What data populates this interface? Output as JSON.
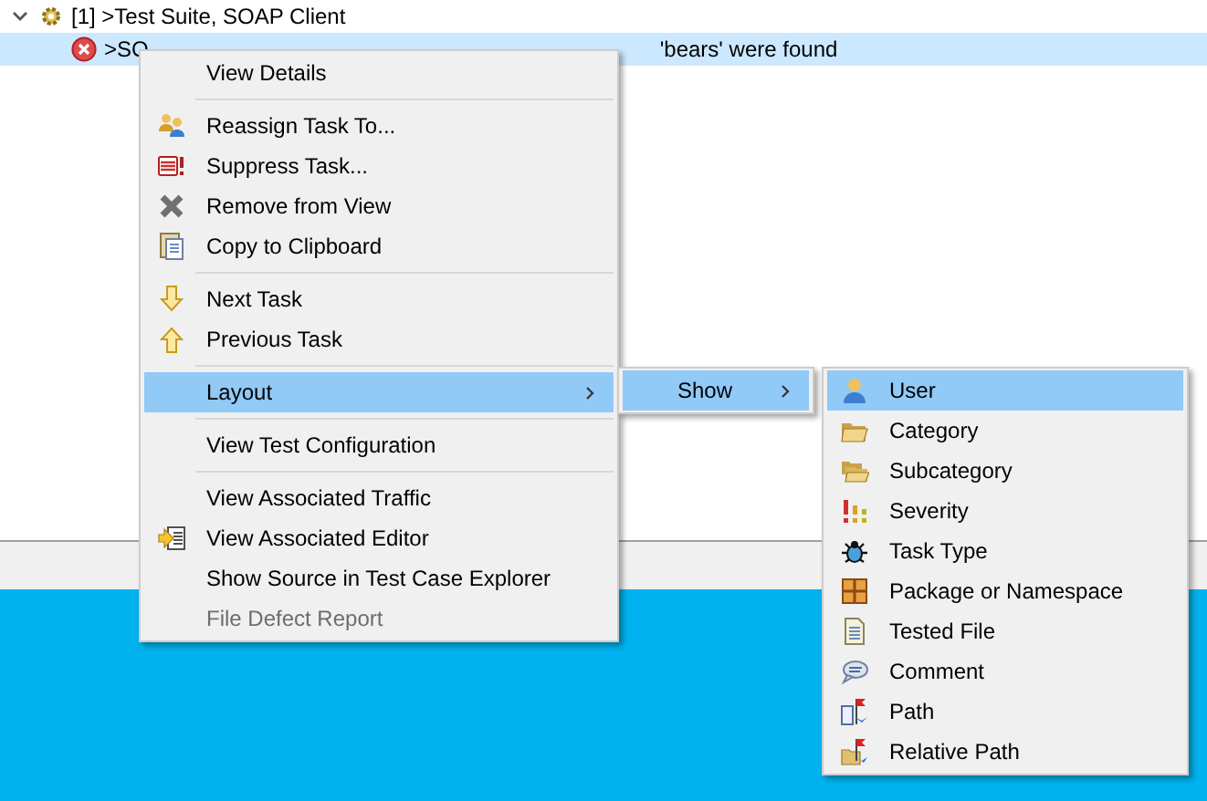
{
  "tree": [
    {
      "label": "[1] >Test Suite, SOAP Client",
      "expanded": true,
      "children": [
        {
          "label_start": ">SO",
          "label_end": "'bears' were found",
          "selected": true,
          "error": true
        }
      ]
    }
  ],
  "context_menu": {
    "items": [
      {
        "kind": "item",
        "label": "View Details",
        "selected": false,
        "disabled": false,
        "submenu": false
      },
      {
        "kind": "separator"
      },
      {
        "kind": "item",
        "label": "Reassign Task To...",
        "selected": false,
        "disabled": false,
        "submenu": false
      },
      {
        "kind": "item",
        "label": "Suppress Task...",
        "selected": false,
        "disabled": false,
        "submenu": false
      },
      {
        "kind": "item",
        "label": "Remove from View",
        "selected": false,
        "disabled": false,
        "submenu": false
      },
      {
        "kind": "item",
        "label": "Copy to Clipboard",
        "selected": false,
        "disabled": false,
        "submenu": false
      },
      {
        "kind": "separator"
      },
      {
        "kind": "item",
        "label": "Next Task",
        "selected": false,
        "disabled": false,
        "submenu": false
      },
      {
        "kind": "item",
        "label": "Previous Task",
        "selected": false,
        "disabled": false,
        "submenu": false
      },
      {
        "kind": "separator"
      },
      {
        "kind": "item",
        "label": "Layout",
        "selected": true,
        "disabled": false,
        "submenu": true
      },
      {
        "kind": "separator"
      },
      {
        "kind": "item",
        "label": "View Test Configuration",
        "selected": false,
        "disabled": false,
        "submenu": false
      },
      {
        "kind": "separator"
      },
      {
        "kind": "item",
        "label": "View Associated Traffic",
        "selected": false,
        "disabled": false,
        "submenu": false
      },
      {
        "kind": "item",
        "label": "View Associated Editor",
        "selected": false,
        "disabled": false,
        "submenu": false
      },
      {
        "kind": "item",
        "label": "Show Source in Test Case Explorer",
        "selected": false,
        "disabled": false,
        "submenu": false
      },
      {
        "kind": "item",
        "label": "File Defect Report",
        "selected": false,
        "disabled": true,
        "submenu": false
      }
    ]
  },
  "layout_submenu": {
    "items": [
      {
        "kind": "item",
        "label": "Show",
        "selected": true,
        "disabled": false,
        "submenu": true
      }
    ]
  },
  "show_submenu": {
    "items": [
      {
        "kind": "item",
        "label": "User",
        "selected": true,
        "disabled": false,
        "submenu": false
      },
      {
        "kind": "item",
        "label": "Category",
        "selected": false,
        "disabled": false,
        "submenu": false
      },
      {
        "kind": "item",
        "label": "Subcategory",
        "selected": false,
        "disabled": false,
        "submenu": false
      },
      {
        "kind": "item",
        "label": "Severity",
        "selected": false,
        "disabled": false,
        "submenu": false
      },
      {
        "kind": "item",
        "label": "Task Type",
        "selected": false,
        "disabled": false,
        "submenu": false
      },
      {
        "kind": "item",
        "label": "Package or Namespace",
        "selected": false,
        "disabled": false,
        "submenu": false
      },
      {
        "kind": "item",
        "label": "Tested File",
        "selected": false,
        "disabled": false,
        "submenu": false
      },
      {
        "kind": "item",
        "label": "Comment",
        "selected": false,
        "disabled": false,
        "submenu": false
      },
      {
        "kind": "item",
        "label": "Path",
        "selected": false,
        "disabled": false,
        "submenu": false
      },
      {
        "kind": "item",
        "label": "Relative Path",
        "selected": false,
        "disabled": false,
        "submenu": false
      }
    ]
  }
}
